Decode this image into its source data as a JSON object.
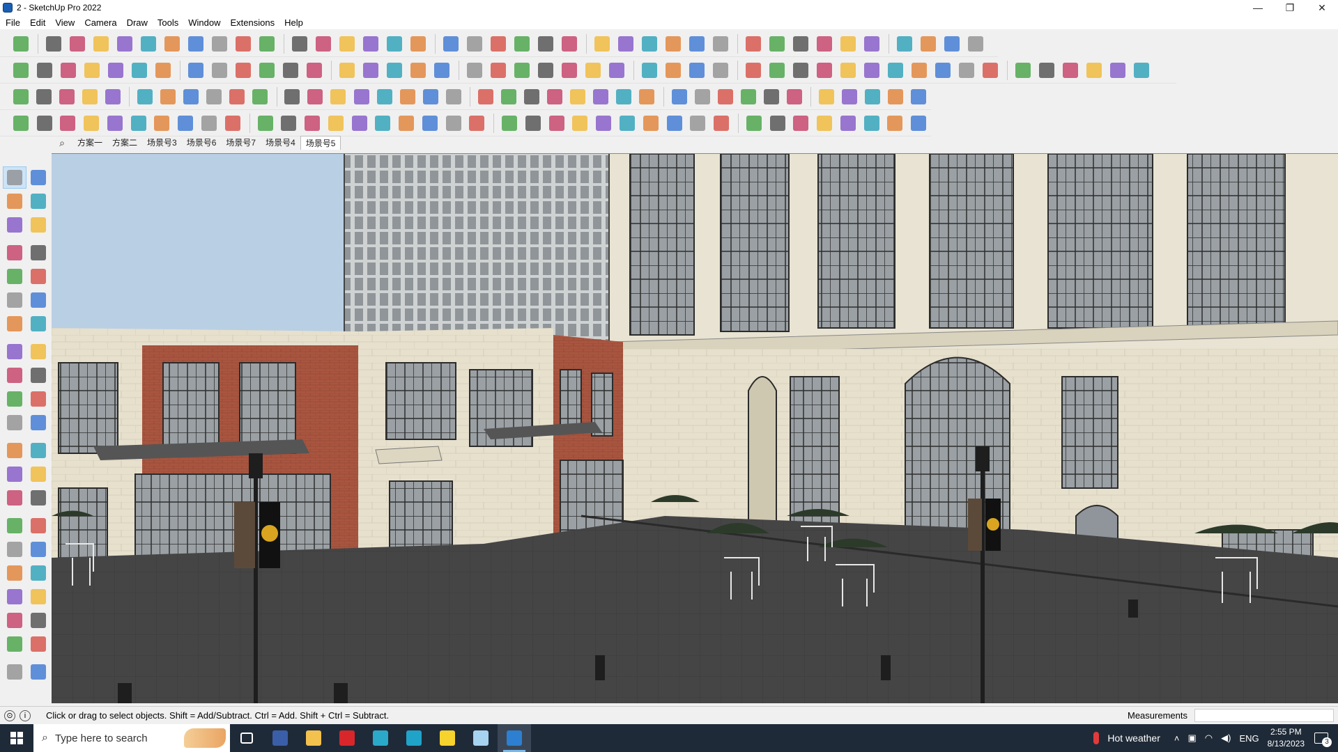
{
  "window": {
    "title": "2 - SketchUp Pro 2022",
    "controls": [
      "—",
      "❐",
      "✕"
    ]
  },
  "menu": [
    "File",
    "Edit",
    "View",
    "Camera",
    "Draw",
    "Tools",
    "Window",
    "Extensions",
    "Help"
  ],
  "scene_tabs": {
    "items": [
      "方案一",
      "方案二",
      "场景号3",
      "场景号6",
      "场景号7",
      "场景号4",
      "场景号5"
    ],
    "active_index": 6
  },
  "status": {
    "message": "Click or drag to select objects. Shift = Add/Subtract. Ctrl = Add. Shift + Ctrl = Subtract.",
    "measurements_label": "Measurements",
    "measurements_value": ""
  },
  "taskbar": {
    "search_placeholder": "Type here to search",
    "apps": [
      "task-view",
      "calculator",
      "file-explorer",
      "acrobat",
      "app-teal",
      "edge",
      "sticky-notes",
      "app-light-blue",
      "sketchup"
    ],
    "weather": "Hot weather",
    "language": "ENG",
    "time": "2:55 PM",
    "date": "8/13/2023"
  },
  "colors": {
    "sky": "#b9cfe4",
    "facade": "#e8e3d2",
    "brick": "#a9553f",
    "glass": "#a9aeb2",
    "ground": "#3f3f40",
    "accent": "#76b9ed"
  }
}
